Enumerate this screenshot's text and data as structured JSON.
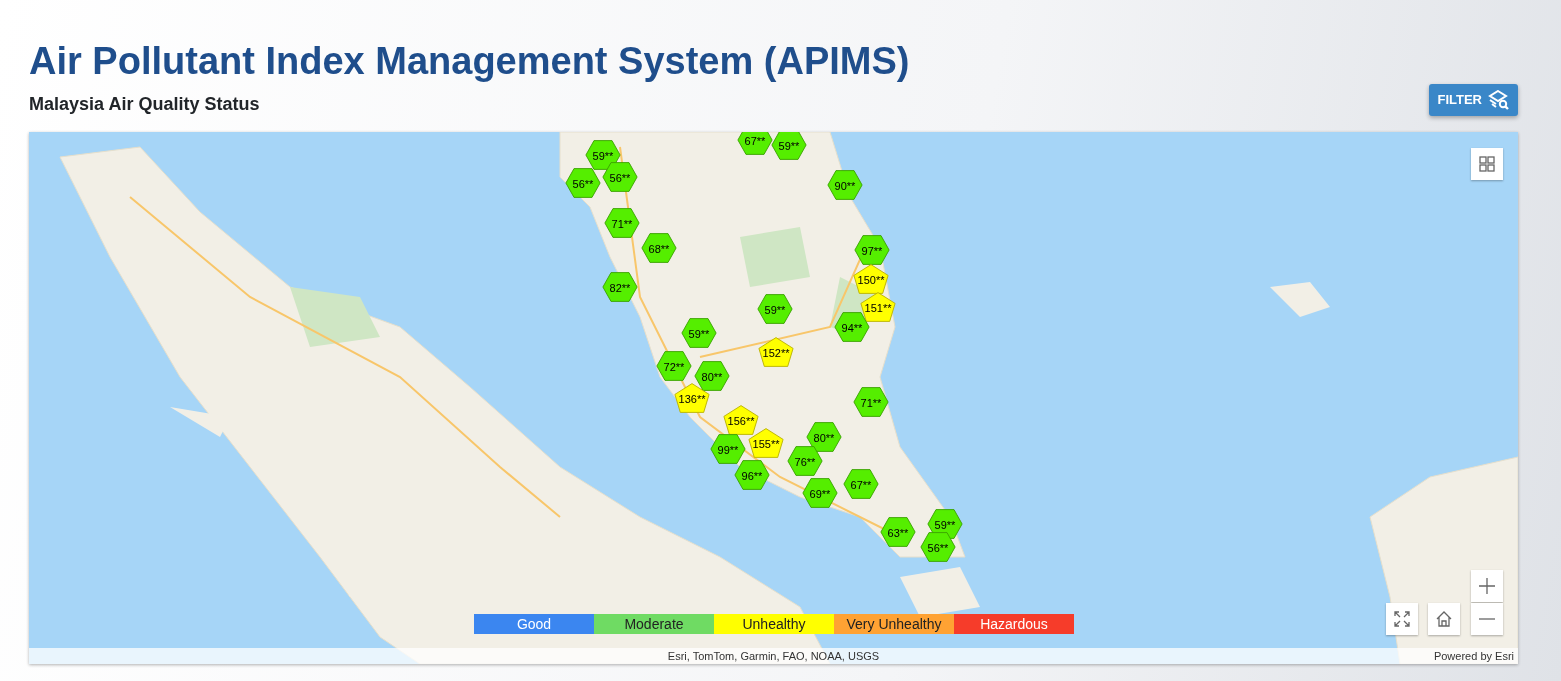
{
  "header": {
    "title": "Air Pollutant Index Management System (APIMS)",
    "subtitle": "Malaysia Air Quality Status"
  },
  "filter_button": {
    "label": "FILTER"
  },
  "map": {
    "markers": [
      {
        "reading": "67**",
        "color": "#55ee00",
        "kind": "hexagon"
      },
      {
        "reading": "59**",
        "color": "#55ee00",
        "kind": "hexagon"
      },
      {
        "reading": "59**",
        "color": "#55ee00",
        "kind": "hexagon"
      },
      {
        "reading": "56**",
        "color": "#55ee00",
        "kind": "hexagon"
      },
      {
        "reading": "56**",
        "color": "#55ee00",
        "kind": "hexagon"
      },
      {
        "reading": "90**",
        "color": "#55ee00",
        "kind": "hexagon"
      },
      {
        "reading": "71**",
        "color": "#55ee00",
        "kind": "hexagon"
      },
      {
        "reading": "68**",
        "color": "#55ee00",
        "kind": "hexagon"
      },
      {
        "reading": "97**",
        "color": "#55ee00",
        "kind": "hexagon"
      },
      {
        "reading": "82**",
        "color": "#55ee00",
        "kind": "hexagon"
      },
      {
        "reading": "150**",
        "color": "#ffff00",
        "kind": "pentagon"
      },
      {
        "reading": "59**",
        "color": "#55ee00",
        "kind": "hexagon"
      },
      {
        "reading": "151**",
        "color": "#ffff00",
        "kind": "pentagon"
      },
      {
        "reading": "94**",
        "color": "#55ee00",
        "kind": "hexagon"
      },
      {
        "reading": "59**",
        "color": "#55ee00",
        "kind": "hexagon"
      },
      {
        "reading": "152**",
        "color": "#ffff00",
        "kind": "pentagon"
      },
      {
        "reading": "72**",
        "color": "#55ee00",
        "kind": "hexagon"
      },
      {
        "reading": "80**",
        "color": "#55ee00",
        "kind": "hexagon"
      },
      {
        "reading": "136**",
        "color": "#ffff00",
        "kind": "pentagon"
      },
      {
        "reading": "71**",
        "color": "#55ee00",
        "kind": "hexagon"
      },
      {
        "reading": "156**",
        "color": "#ffff00",
        "kind": "pentagon"
      },
      {
        "reading": "80**",
        "color": "#55ee00",
        "kind": "hexagon"
      },
      {
        "reading": "99**",
        "color": "#55ee00",
        "kind": "hexagon"
      },
      {
        "reading": "155**",
        "color": "#ffff00",
        "kind": "pentagon"
      },
      {
        "reading": "96**",
        "color": "#55ee00",
        "kind": "hexagon"
      },
      {
        "reading": "76**",
        "color": "#55ee00",
        "kind": "hexagon"
      },
      {
        "reading": "67**",
        "color": "#55ee00",
        "kind": "hexagon"
      },
      {
        "reading": "69**",
        "color": "#55ee00",
        "kind": "hexagon"
      },
      {
        "reading": "63**",
        "color": "#55ee00",
        "kind": "hexagon"
      },
      {
        "reading": "59**",
        "color": "#55ee00",
        "kind": "hexagon"
      },
      {
        "reading": "56**",
        "color": "#55ee00",
        "kind": "hexagon"
      }
    ],
    "legend": [
      {
        "label": "Good",
        "color": "#3b86f0"
      },
      {
        "label": "Moderate",
        "color": "#6fdb63"
      },
      {
        "label": "Unhealthy",
        "color": "#ffff00"
      },
      {
        "label": "Very Unhealthy",
        "color": "#ffa233"
      },
      {
        "label": "Hazardous",
        "color": "#f63c2a"
      }
    ],
    "attribution": "Esri, TomTom, Garmin, FAO, NOAA, USGS",
    "powered_by": "Powered by Esri"
  }
}
